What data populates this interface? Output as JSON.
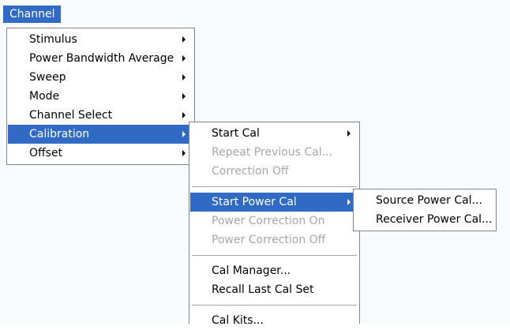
{
  "menubar": {
    "channel_label": "Channel"
  },
  "channel_menu": {
    "items": [
      {
        "label": "Stimulus"
      },
      {
        "label": "Power Bandwidth Average"
      },
      {
        "label": "Sweep"
      },
      {
        "label": "Mode"
      },
      {
        "label": "Channel Select"
      },
      {
        "label": "Calibration"
      },
      {
        "label": "Offset"
      }
    ]
  },
  "calibration_menu": {
    "items": [
      {
        "label": "Start Cal"
      },
      {
        "label": "Repeat Previous Cal..."
      },
      {
        "label": "Correction Off"
      },
      {
        "label": "Start Power Cal"
      },
      {
        "label": "Power Correction On"
      },
      {
        "label": "Power Correction Off"
      },
      {
        "label": "Cal Manager..."
      },
      {
        "label": "Recall Last Cal Set"
      },
      {
        "label": "Cal Kits..."
      }
    ]
  },
  "power_cal_menu": {
    "items": [
      {
        "label": "Source Power Cal..."
      },
      {
        "label": "Receiver Power Cal..."
      }
    ]
  },
  "colors": {
    "highlight": "#316ac5",
    "disabled_text": "#a7a6aa",
    "border": "#848484"
  }
}
